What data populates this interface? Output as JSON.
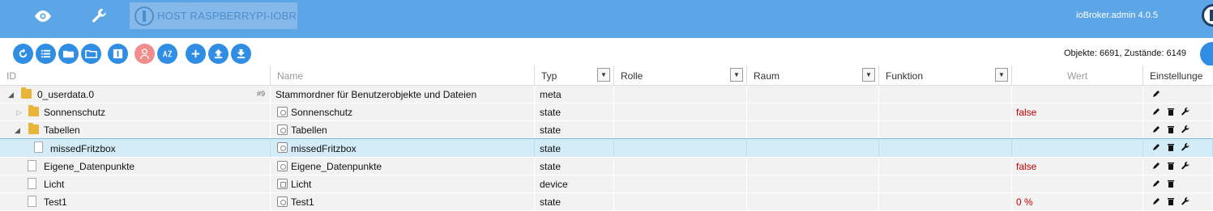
{
  "topbar": {
    "host_label": "HOST RASPBERRYPI-IOBR",
    "version": "ioBroker.admin 4.0.5"
  },
  "toolbar": {
    "counts": "Objekte: 6691, Zustände: 6149"
  },
  "columns": {
    "id": "ID",
    "name": "Name",
    "type": "Typ",
    "role": "Rolle",
    "room": "Raum",
    "function": "Funktion",
    "value": "Wert",
    "settings": "Einstellunge"
  },
  "rows": [
    {
      "id": "0_userdata.0",
      "count": "#9",
      "name": "Stammordner für Benutzerobjekte und Dateien",
      "type": "meta",
      "value": ""
    },
    {
      "id": "Sonnenschutz",
      "name": "Sonnenschutz",
      "type": "state",
      "value": "false"
    },
    {
      "id": "Tabellen",
      "name": "Tabellen",
      "type": "state",
      "value": ""
    },
    {
      "id": "missedFritzbox",
      "name": "missedFritzbox",
      "type": "state",
      "value": ""
    },
    {
      "id": "Eigene_Datenpunkte",
      "name": "Eigene_Datenpunkte",
      "type": "state",
      "value": "false"
    },
    {
      "id": "Licht",
      "name": "Licht",
      "type": "device",
      "value": ""
    },
    {
      "id": "Test1",
      "name": "Test1",
      "type": "state",
      "value": "0 %"
    }
  ],
  "colors": {
    "topbar": "#5ca6e8",
    "button": "#2f8de4",
    "value_red": "#c00000",
    "selected_row": "#d4ebf8"
  }
}
